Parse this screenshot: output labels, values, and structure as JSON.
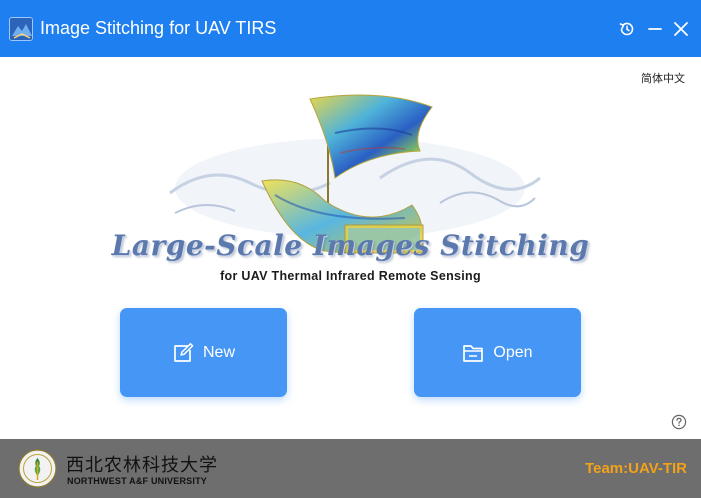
{
  "window": {
    "title": "Image Stitching for UAV TIRS",
    "controls": {
      "history_icon": "history-clock-icon",
      "minimize_icon": "minimize-icon",
      "close_icon": "close-icon"
    }
  },
  "main": {
    "language_link": "简体中文",
    "hero": {
      "headline": "Large-Scale  Images Stitching",
      "subline": "for UAV Thermal Infrared Remote Sensing"
    },
    "buttons": {
      "new_label": "New",
      "new_icon": "edit-square-icon",
      "open_label": "Open",
      "open_icon": "folder-icon"
    },
    "help_icon": "help-circle-icon"
  },
  "footer": {
    "university_cn": "西北农林科技大学",
    "university_en": "NORTHWEST A&F UNIVERSITY",
    "team": "Team:UAV-TIR"
  },
  "colors": {
    "titlebar": "#1e7ff0",
    "button": "#4596f5",
    "footer": "#6e6e6e",
    "team_text": "#f2a11a",
    "headline": "#5c79ad"
  }
}
